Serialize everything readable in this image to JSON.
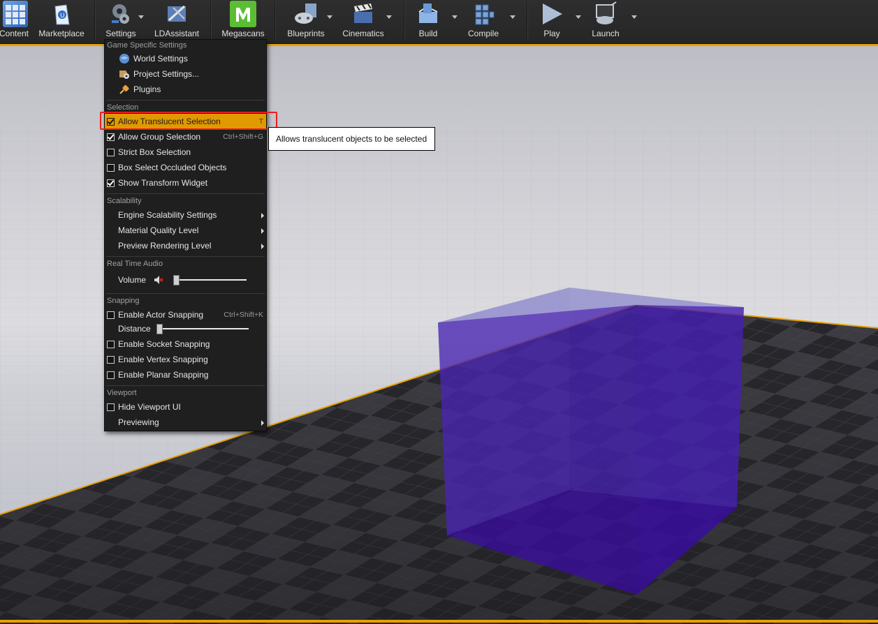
{
  "toolbar": {
    "buttons": [
      {
        "label": "Content",
        "icon": "content-icon"
      },
      {
        "label": "Marketplace",
        "icon": "marketplace-icon"
      },
      {
        "label": "Settings",
        "icon": "settings-icon"
      },
      {
        "label": "LDAssistant",
        "icon": "ldassistant-icon"
      },
      {
        "label": "Megascans",
        "icon": "megascans-icon"
      },
      {
        "label": "Blueprints",
        "icon": "blueprints-icon"
      },
      {
        "label": "Cinematics",
        "icon": "cinematics-icon"
      },
      {
        "label": "Build",
        "icon": "build-icon"
      },
      {
        "label": "Compile",
        "icon": "compile-icon"
      },
      {
        "label": "Play",
        "icon": "play-icon"
      },
      {
        "label": "Launch",
        "icon": "launch-icon"
      }
    ]
  },
  "menu": {
    "sections": {
      "game": "Game Specific Settings",
      "selection": "Selection",
      "scalability": "Scalability",
      "audio": "Real Time Audio",
      "snapping": "Snapping",
      "viewport": "Viewport"
    },
    "items": {
      "world_settings": "World Settings",
      "project_settings": "Project Settings...",
      "plugins": "Plugins",
      "allow_translucent": {
        "label": "Allow Translucent Selection",
        "shortcut": "T",
        "checked": true
      },
      "allow_group": {
        "label": "Allow Group Selection",
        "shortcut": "Ctrl+Shift+G",
        "checked": true
      },
      "strict_box": {
        "label": "Strict Box Selection",
        "checked": false
      },
      "box_occluded": {
        "label": "Box Select Occluded Objects",
        "checked": false
      },
      "show_transform": {
        "label": "Show Transform Widget",
        "checked": true
      },
      "engine_scalability": "Engine Scalability Settings",
      "material_quality": "Material Quality Level",
      "preview_rendering": "Preview Rendering Level",
      "volume": {
        "label": "Volume",
        "value": 0.0
      },
      "actor_snapping": {
        "label": "Enable Actor Snapping",
        "shortcut": "Ctrl+Shift+K",
        "checked": false
      },
      "distance": {
        "label": "Distance",
        "value": 0.0
      },
      "socket_snapping": {
        "label": "Enable Socket Snapping",
        "checked": false
      },
      "vertex_snapping": {
        "label": "Enable Vertex Snapping",
        "checked": false
      },
      "planar_snapping": {
        "label": "Enable Planar Snapping",
        "checked": false
      },
      "hide_viewport_ui": {
        "label": "Hide Viewport UI",
        "checked": false
      },
      "previewing": "Previewing"
    }
  },
  "tooltip": "Allows translucent objects to be selected",
  "colors": {
    "highlight": "#e09a00",
    "annotation": "#ee1c1c",
    "cube": "#3a0aa8",
    "selection_outline": "#e8a000"
  }
}
